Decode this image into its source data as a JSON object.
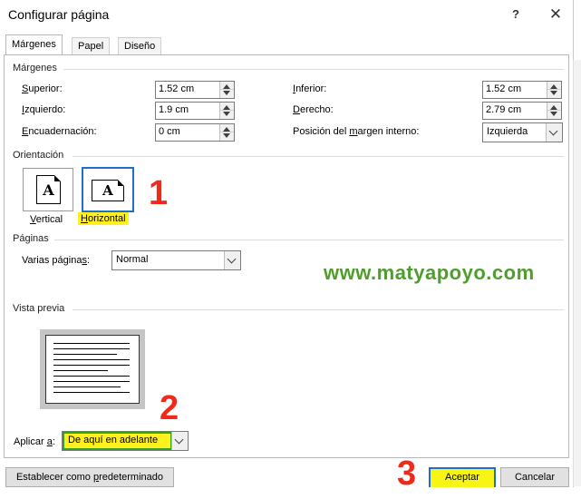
{
  "window": {
    "title": "Configurar página",
    "help_label": "?",
    "close_label": "✕"
  },
  "tabs": [
    {
      "label": "Márgenes",
      "active": true
    },
    {
      "label": "Papel",
      "active": false
    },
    {
      "label": "Diseño",
      "active": false
    }
  ],
  "margins": {
    "section_title": "Márgenes",
    "top": {
      "label_u": "S",
      "label_rest": "uperior:",
      "value": "1.52 cm"
    },
    "left": {
      "label_u": "I",
      "label_rest": "zquierdo:",
      "value": "1.9 cm"
    },
    "gutter": {
      "label_u": "E",
      "label_rest": "ncuadernación:",
      "value": "0 cm"
    },
    "bottom": {
      "label_u": "I",
      "label_rest": "nferior:",
      "value": "1.52 cm"
    },
    "right": {
      "label_u": "D",
      "label_rest": "erecho:",
      "value": "2.79 cm"
    },
    "gutter_pos": {
      "label_pre": "Posición del ",
      "label_u": "m",
      "label_rest": "argen interno:",
      "value": "Izquierda"
    }
  },
  "orientation": {
    "section_title": "Orientación",
    "portrait": {
      "label_u": "V",
      "label_rest": "ertical",
      "letter": "A",
      "selected": false
    },
    "landscape": {
      "label_u": "H",
      "label_rest": "orizontal",
      "letter": "A",
      "selected": true
    }
  },
  "pages": {
    "section_title": "Páginas",
    "multiple_label_pre": "Varias página",
    "multiple_label_u": "s",
    "multiple_label_rest": ":",
    "multiple_value": "Normal"
  },
  "preview": {
    "section_title": "Vista previa",
    "apply_label_pre": "Aplicar ",
    "apply_label_u": "a",
    "apply_label_rest": ":",
    "apply_value": "De aquí en adelante"
  },
  "buttons": {
    "set_default_pre": "Establecer como ",
    "set_default_u": "p",
    "set_default_rest": "redeterminado",
    "ok": "Aceptar",
    "cancel": "Cancelar"
  },
  "annotations": {
    "step1": "1",
    "step2": "2",
    "step3": "3",
    "watermark": "www.matyapoyo.com"
  },
  "colors": {
    "highlight": "#fff01e",
    "annotation_red": "#ee2a1b",
    "watermark_green": "#4f9e2c",
    "selection_blue": "#1e6fc7"
  }
}
